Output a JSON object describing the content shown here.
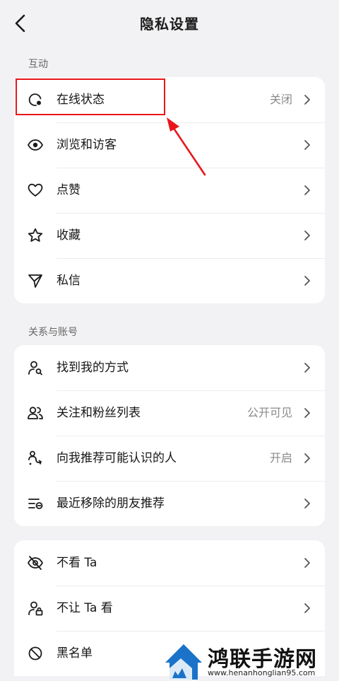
{
  "header": {
    "title": "隐私设置"
  },
  "sections": [
    {
      "label": "互动",
      "items": [
        {
          "label": "在线状态",
          "value": "关闭",
          "icon": "online-status-icon"
        },
        {
          "label": "浏览和访客",
          "value": "",
          "icon": "eye-icon"
        },
        {
          "label": "点赞",
          "value": "",
          "icon": "heart-icon"
        },
        {
          "label": "收藏",
          "value": "",
          "icon": "star-icon"
        },
        {
          "label": "私信",
          "value": "",
          "icon": "send-icon"
        }
      ]
    },
    {
      "label": "关系与账号",
      "items": [
        {
          "label": "找到我的方式",
          "value": "",
          "icon": "user-search-icon"
        },
        {
          "label": "关注和粉丝列表",
          "value": "公开可见",
          "icon": "users-icon"
        },
        {
          "label": "向我推荐可能认识的人",
          "value": "开启",
          "icon": "recommend-icon"
        },
        {
          "label": "最近移除的朋友推荐",
          "value": "",
          "icon": "list-removed-icon"
        }
      ]
    },
    {
      "label": "",
      "items": [
        {
          "label": "不看 Ta",
          "value": "",
          "icon": "eye-off-icon"
        },
        {
          "label": "不让 Ta 看",
          "value": "",
          "icon": "user-lock-icon"
        },
        {
          "label": "黑名单",
          "value": "",
          "icon": "block-icon"
        }
      ]
    }
  ],
  "watermark": {
    "name": "鸿联手游网",
    "url": "www.henanhonglian95.com"
  },
  "colors": {
    "highlight": "#e8161b",
    "background": "#f2f2f4"
  }
}
